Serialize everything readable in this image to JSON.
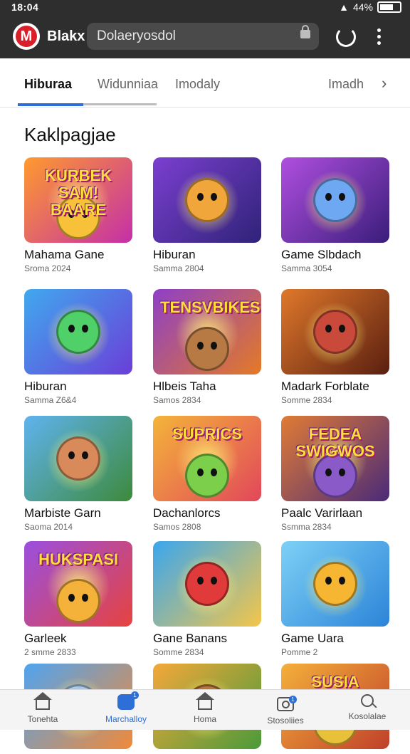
{
  "status_bar": {
    "time": "18:04",
    "battery": "44%"
  },
  "browser": {
    "brand": "Blakx",
    "url": "Dolaeryosdol",
    "logo_letter": "M"
  },
  "tabs": [
    {
      "label": "Hiburaa",
      "active": true
    },
    {
      "label": "Widunniaa",
      "active": false
    },
    {
      "label": "Imodaly",
      "active": false
    },
    {
      "label": "Imadh",
      "active": false
    }
  ],
  "section_title": "Kaklpagjae",
  "games": [
    {
      "name": "Mahama Gane",
      "sub": "Sroma 2024",
      "banner": "KURBEK SAM! BAARE",
      "bg_from": "#ff9a2e",
      "bg_to": "#c42fa8",
      "char": "#f7c23a"
    },
    {
      "name": "Hiburan",
      "sub": "Samma 2804",
      "banner": "",
      "bg_from": "#7b3fd0",
      "bg_to": "#2f2378",
      "char": "#f0a63a"
    },
    {
      "name": "Game Slbdach",
      "sub": "Samma 3054",
      "banner": "",
      "bg_from": "#b04fe0",
      "bg_to": "#3a1d7a",
      "char": "#6ea7f2"
    },
    {
      "name": "Hiburan",
      "sub": "Samma Z6&4",
      "banner": "",
      "bg_from": "#40a9ef",
      "bg_to": "#6a3ed8",
      "char": "#4fd068"
    },
    {
      "name": "Hlbeis Taha",
      "sub": "Samos 2834",
      "banner": "TENSVBIKES",
      "bg_from": "#8e3fc9",
      "bg_to": "#e47a25",
      "char": "#b77a45"
    },
    {
      "name": "Madark Forblate",
      "sub": "Somme 2834",
      "banner": "",
      "bg_from": "#e0782b",
      "bg_to": "#5a1f10",
      "char": "#c94a3a"
    },
    {
      "name": "Marbiste Garn",
      "sub": "Saoma 2014",
      "banner": "",
      "bg_from": "#5fb3ef",
      "bg_to": "#3d8a3c",
      "char": "#d98a5a"
    },
    {
      "name": "Dachanlorcs",
      "sub": "Samos 2808",
      "banner": "SUPRICS",
      "bg_from": "#f4b43a",
      "bg_to": "#e2475a",
      "char": "#7bcf4a"
    },
    {
      "name": "Paalc Varirlaan",
      "sub": "Ssmma 2834",
      "banner": "FEDEA SWIGWOS",
      "bg_from": "#e17b35",
      "bg_to": "#4a2a78",
      "char": "#8a5ac8"
    },
    {
      "name": "Garleek",
      "sub": "2 smme 2833",
      "banner": "HUKSPASI",
      "bg_from": "#9a4fe0",
      "bg_to": "#e6433f",
      "char": "#f4b23a"
    },
    {
      "name": "Gane Banans",
      "sub": "Somme 2834",
      "banner": "",
      "bg_from": "#3aa6ef",
      "bg_to": "#f4c64a",
      "char": "#e03a3a"
    },
    {
      "name": "Game Uara",
      "sub": "Pomme 2",
      "banner": "",
      "bg_from": "#7dd1f6",
      "bg_to": "#2c84d8",
      "char": "#f6b632"
    },
    {
      "name": "",
      "sub": "",
      "banner": "",
      "bg_from": "#4fa4f0",
      "bg_to": "#f08a3a",
      "char": "#a8c8ea"
    },
    {
      "name": "",
      "sub": "",
      "banner": "",
      "bg_from": "#f4a83a",
      "bg_to": "#4b9a3a",
      "char": "#b8753a"
    },
    {
      "name": "",
      "sub": "",
      "banner": "SUSIA",
      "bg_from": "#f4b03a",
      "bg_to": "#c0402a",
      "char": "#e8c03a"
    }
  ],
  "bottom_nav": [
    {
      "label": "Tonehta",
      "icon": "home-icon",
      "active": false
    },
    {
      "label": "Marchalloy",
      "icon": "chat-icon",
      "active": true,
      "badge": "1"
    },
    {
      "label": "Homa",
      "icon": "house-icon",
      "active": false
    },
    {
      "label": "Stosoliies",
      "icon": "camera-icon",
      "active": false,
      "badge": "1"
    },
    {
      "label": "Kosolalae",
      "icon": "search-icon",
      "active": false
    }
  ],
  "colors": {
    "accent": "#2d6fd6",
    "topbar": "#2e2e2e"
  }
}
